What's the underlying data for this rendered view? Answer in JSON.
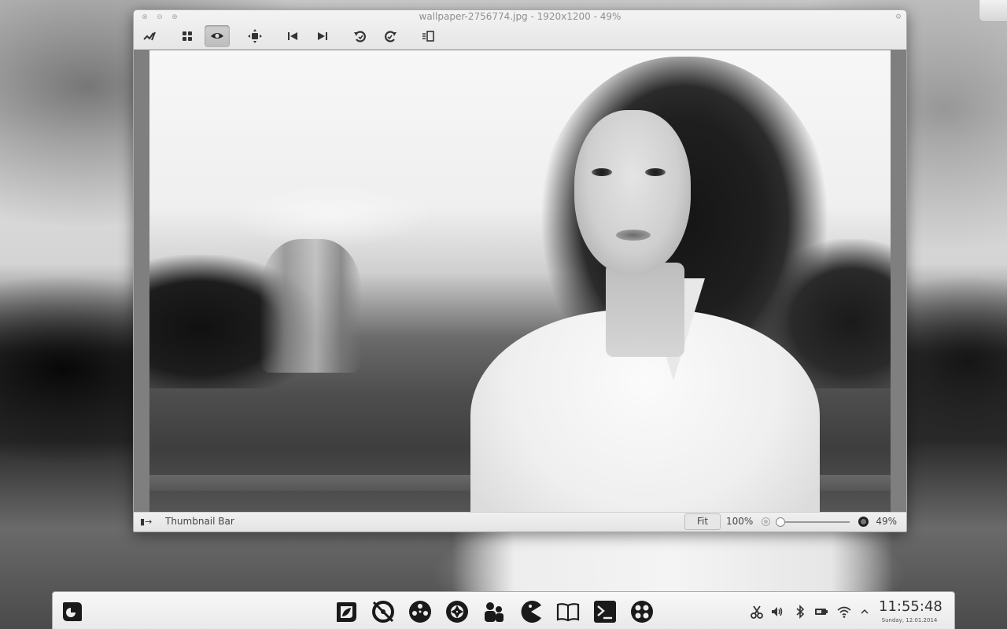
{
  "window": {
    "title": "wallpaper-2756774.jpg - 1920x1200 - 49%"
  },
  "toolbar": {
    "buttons": [
      {
        "id": "edit",
        "icon": "pencil-line-icon"
      },
      {
        "id": "browse",
        "icon": "grid-icon"
      },
      {
        "id": "view",
        "icon": "eye-icon",
        "active": true
      },
      {
        "id": "fullscreen",
        "icon": "move-arrows-icon"
      },
      {
        "id": "previous",
        "icon": "skip-back-icon"
      },
      {
        "id": "next",
        "icon": "skip-forward-icon"
      },
      {
        "id": "rotate-left",
        "icon": "rotate-left-icon"
      },
      {
        "id": "rotate-right",
        "icon": "rotate-right-icon"
      },
      {
        "id": "sidebar",
        "icon": "sidebar-icon"
      }
    ]
  },
  "statusbar": {
    "thumbnail_icon": "▮→",
    "thumbnail_label": "Thumbnail Bar",
    "fit_label": "Fit",
    "actual_size_label": "100%",
    "zoom_value": "49%",
    "zoom_slider_fraction": 0.02
  },
  "taskbar": {
    "launcher_icon": "app-launcher-icon",
    "apps": [
      "image-viewer-icon",
      "disc-burner-icon",
      "media-player-icon",
      "camera-aperture-icon",
      "contacts-icon",
      "pacman-game-icon",
      "book-reader-icon",
      "terminal-icon",
      "video-editor-icon"
    ],
    "tray": [
      "scissors-icon",
      "volume-icon",
      "bluetooth-icon",
      "battery-icon",
      "wifi-icon",
      "chevron-up-icon"
    ],
    "clock": "11:55:48",
    "date": "Sunday, 12.01.2014"
  }
}
